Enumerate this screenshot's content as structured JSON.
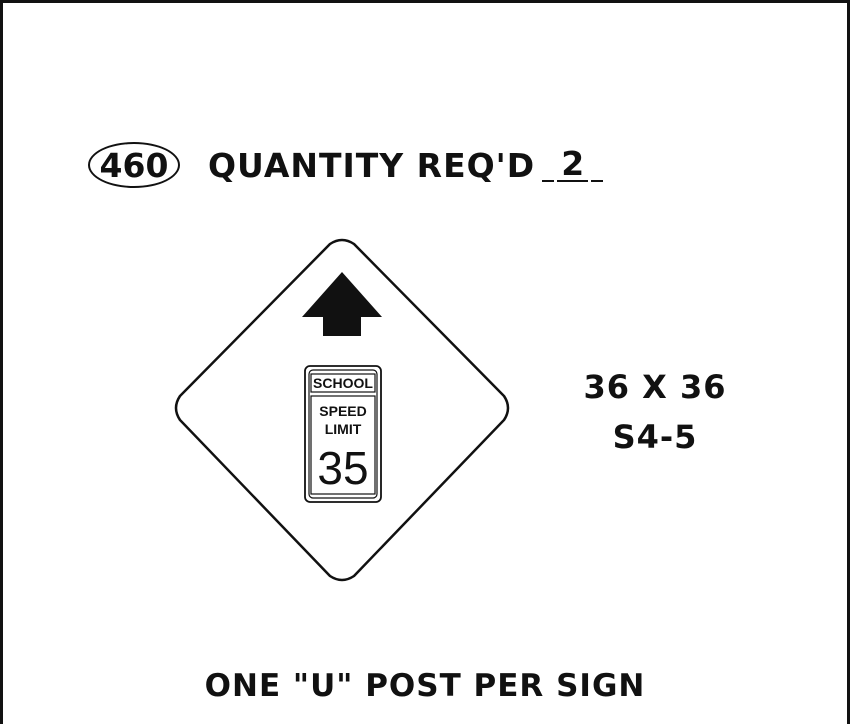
{
  "sign_id": "460",
  "quantity_label": "QUANTITY REQ'D",
  "quantity_value": "2",
  "sign": {
    "school_label": "SCHOOL",
    "speed_label": "SPEED",
    "limit_label": "LIMIT",
    "speed_value": "35",
    "arrow_icon": "up-arrow-icon"
  },
  "dimensions": "36 X 36",
  "sign_code": "S4-5",
  "footer_note": "ONE \"U\" POST PER SIGN"
}
